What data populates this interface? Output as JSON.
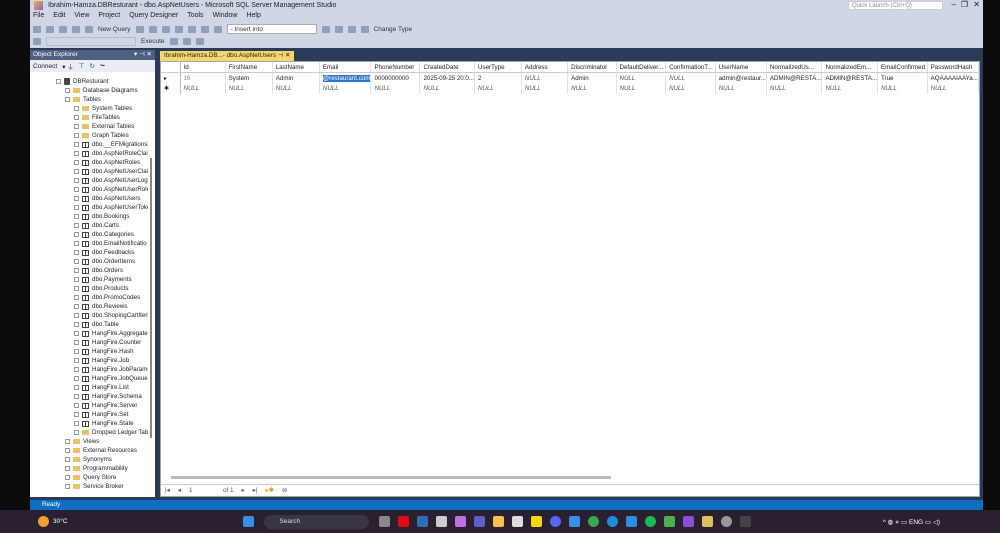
{
  "window": {
    "title": "Ibrahim-Hamza.DBResturant - dbo.AspNetUsers - Microsoft SQL Server Management Studio",
    "quick_launch": "Quick Launch (Ctrl+Q)"
  },
  "menu": [
    "File",
    "Edit",
    "View",
    "Project",
    "Query Designer",
    "Tools",
    "Window",
    "Help"
  ],
  "toolbar": {
    "new_query": "New Query",
    "insert_into": "- Insert into",
    "change_type": "Change Type",
    "execute": "Execute"
  },
  "object_explorer": {
    "title": "Object Explorer",
    "connect": "Connect",
    "tree": [
      {
        "label": "DBResturant",
        "level": 0,
        "kind": "db"
      },
      {
        "label": "Database Diagrams",
        "level": 1,
        "kind": "folder"
      },
      {
        "label": "Tables",
        "level": 1,
        "kind": "folder"
      },
      {
        "label": "System Tables",
        "level": 2,
        "kind": "folder"
      },
      {
        "label": "FileTables",
        "level": 2,
        "kind": "folder"
      },
      {
        "label": "External Tables",
        "level": 2,
        "kind": "folder"
      },
      {
        "label": "Graph Tables",
        "level": 2,
        "kind": "folder"
      },
      {
        "label": "dbo.__EFMigrationsH",
        "level": 2,
        "kind": "table"
      },
      {
        "label": "dbo.AspNetRoleClair",
        "level": 2,
        "kind": "table"
      },
      {
        "label": "dbo.AspNetRoles",
        "level": 2,
        "kind": "table"
      },
      {
        "label": "dbo.AspNetUserClair",
        "level": 2,
        "kind": "table"
      },
      {
        "label": "dbo.AspNetUserLogi",
        "level": 2,
        "kind": "table"
      },
      {
        "label": "dbo.AspNetUserRole",
        "level": 2,
        "kind": "table"
      },
      {
        "label": "dbo.AspNetUsers",
        "level": 2,
        "kind": "table"
      },
      {
        "label": "dbo.AspNetUserToke",
        "level": 2,
        "kind": "table"
      },
      {
        "label": "dbo.Bookings",
        "level": 2,
        "kind": "table"
      },
      {
        "label": "dbo.Carts",
        "level": 2,
        "kind": "table"
      },
      {
        "label": "dbo.Categories",
        "level": 2,
        "kind": "table"
      },
      {
        "label": "dbo.EmailNotificatio",
        "level": 2,
        "kind": "table"
      },
      {
        "label": "dbo.Feedbacks",
        "level": 2,
        "kind": "table"
      },
      {
        "label": "dbo.OrderItems",
        "level": 2,
        "kind": "table"
      },
      {
        "label": "dbo.Orders",
        "level": 2,
        "kind": "table"
      },
      {
        "label": "dbo.Payments",
        "level": 2,
        "kind": "table"
      },
      {
        "label": "dbo.Products",
        "level": 2,
        "kind": "table"
      },
      {
        "label": "dbo.PromoCodes",
        "level": 2,
        "kind": "table"
      },
      {
        "label": "dbo.Reviews",
        "level": 2,
        "kind": "table"
      },
      {
        "label": "dbo.ShopingCartIten",
        "level": 2,
        "kind": "table"
      },
      {
        "label": "dbo.Table",
        "level": 2,
        "kind": "table"
      },
      {
        "label": "HangFire.Aggregatec",
        "level": 2,
        "kind": "table"
      },
      {
        "label": "HangFire.Counter",
        "level": 2,
        "kind": "table"
      },
      {
        "label": "HangFire.Hash",
        "level": 2,
        "kind": "table"
      },
      {
        "label": "HangFire.Job",
        "level": 2,
        "kind": "table"
      },
      {
        "label": "HangFire.JobParamet",
        "level": 2,
        "kind": "table"
      },
      {
        "label": "HangFire.JobQueue",
        "level": 2,
        "kind": "table"
      },
      {
        "label": "HangFire.List",
        "level": 2,
        "kind": "table"
      },
      {
        "label": "HangFire.Schema",
        "level": 2,
        "kind": "table"
      },
      {
        "label": "HangFire.Server",
        "level": 2,
        "kind": "table"
      },
      {
        "label": "HangFire.Set",
        "level": 2,
        "kind": "table"
      },
      {
        "label": "HangFire.State",
        "level": 2,
        "kind": "table"
      },
      {
        "label": "Dropped Ledger Tabl",
        "level": 2,
        "kind": "folder"
      },
      {
        "label": "Views",
        "level": 1,
        "kind": "folder"
      },
      {
        "label": "External Resources",
        "level": 1,
        "kind": "folder"
      },
      {
        "label": "Synonyms",
        "level": 1,
        "kind": "folder"
      },
      {
        "label": "Programmability",
        "level": 1,
        "kind": "folder"
      },
      {
        "label": "Query Store",
        "level": 1,
        "kind": "folder"
      },
      {
        "label": "Service Broker",
        "level": 1,
        "kind": "folder"
      }
    ]
  },
  "tab": {
    "label": "Ibrahim-Hamza.DB...- dbo.AspNetUsers"
  },
  "grid": {
    "columns": [
      "Id",
      "FirstName",
      "LastName",
      "Email",
      "PhoneNumber",
      "CreatedDate",
      "UserType",
      "Address",
      "Discriminator",
      "DefaultDeliver...",
      "ConfirmationT...",
      "UserName",
      "NormalizedUs...",
      "NormalizedEm...",
      "EmailConfirmed",
      "PasswordHash"
    ],
    "rows": [
      {
        "marker": "▸",
        "cells": [
          "16",
          "System",
          "Admin",
          "@restaurant.com",
          "0000000000",
          "2025-09-25 20:0...",
          "2",
          "NULL",
          "Admin",
          "NULL",
          "NULL",
          "admin@restaur...",
          "ADMIN@RESTA...",
          "ADMIN@RESTA...",
          "True",
          "AQAAAAIAAYa..."
        ]
      },
      {
        "marker": "✱",
        "cells": [
          "NULL",
          "NULL",
          "NULL",
          "NULL",
          "NULL",
          "NULL",
          "NULL",
          "NULL",
          "NULL",
          "NULL",
          "NULL",
          "NULL",
          "NULL",
          "NULL",
          "NULL",
          "NULL"
        ]
      }
    ],
    "pager": {
      "page": "1",
      "of": "of 1"
    }
  },
  "status": "Ready",
  "taskbar": {
    "weather": "30°C",
    "search": "Search",
    "lang": "ENG"
  }
}
